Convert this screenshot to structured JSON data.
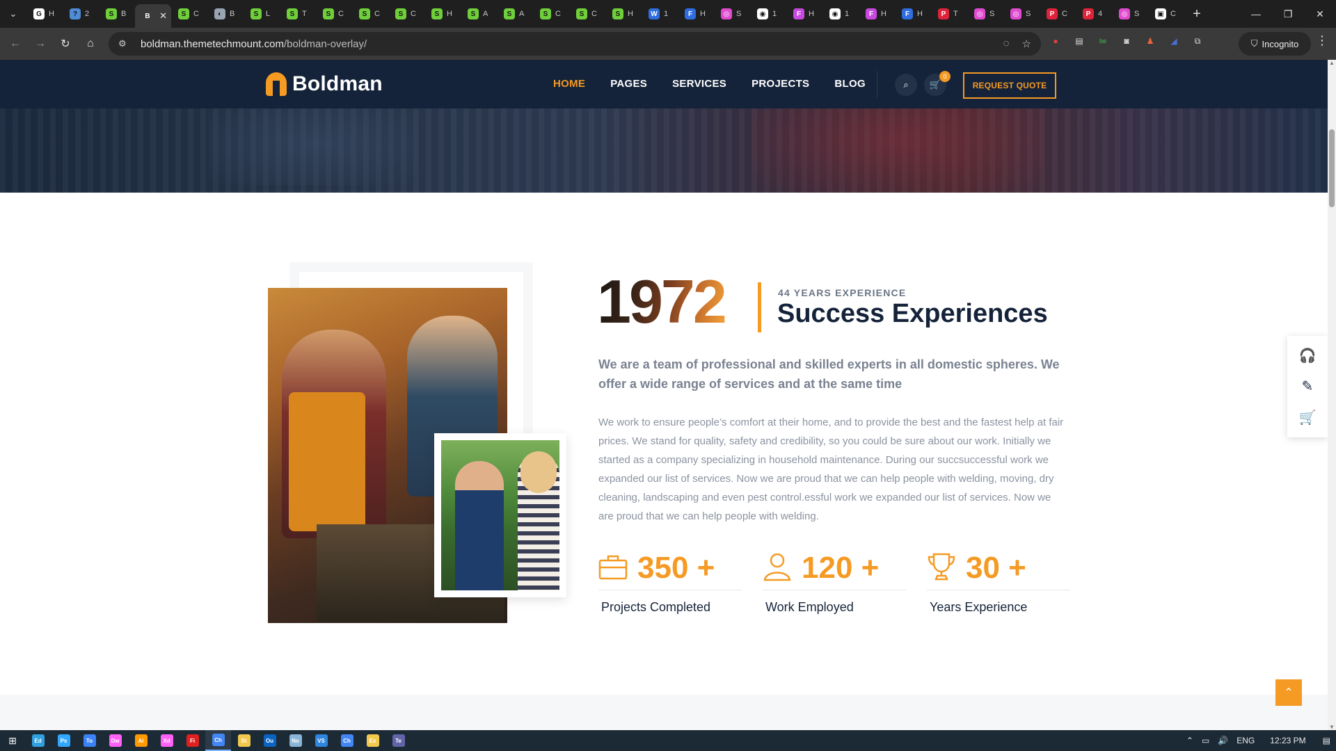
{
  "browser": {
    "tabs": [
      {
        "letter": "G",
        "label": "H",
        "color": "#ffffff"
      },
      {
        "letter": "?",
        "label": "2",
        "color": "#4f8bd6"
      },
      {
        "letter": "S",
        "label": "B",
        "color": "#6fcf3a"
      },
      {
        "letter": "B",
        "label": "",
        "color": "#3a3a3a",
        "active": true
      },
      {
        "letter": "S",
        "label": "C",
        "color": "#6fcf3a"
      },
      {
        "letter": "◐",
        "label": "B",
        "color": "#9aa3b0"
      },
      {
        "letter": "S",
        "label": "L",
        "color": "#6fcf3a"
      },
      {
        "letter": "S",
        "label": "T",
        "color": "#6fcf3a"
      },
      {
        "letter": "S",
        "label": "C",
        "color": "#6fcf3a"
      },
      {
        "letter": "S",
        "label": "C",
        "color": "#6fcf3a"
      },
      {
        "letter": "S",
        "label": "C",
        "color": "#6fcf3a"
      },
      {
        "letter": "S",
        "label": "H",
        "color": "#6fcf3a"
      },
      {
        "letter": "S",
        "label": "A",
        "color": "#6fcf3a"
      },
      {
        "letter": "S",
        "label": "A",
        "color": "#6fcf3a"
      },
      {
        "letter": "S",
        "label": "C",
        "color": "#6fcf3a"
      },
      {
        "letter": "S",
        "label": "C",
        "color": "#6fcf3a"
      },
      {
        "letter": "S",
        "label": "H",
        "color": "#6fcf3a"
      },
      {
        "letter": "W",
        "label": "1",
        "color": "#2f6de0"
      },
      {
        "letter": "F",
        "label": "H",
        "color": "#2f6de0"
      },
      {
        "letter": "◎",
        "label": "S",
        "color": "#e04bd0"
      },
      {
        "letter": "◉",
        "label": "1",
        "color": "#ffffff"
      },
      {
        "letter": "F",
        "label": "H",
        "color": "#c848e0"
      },
      {
        "letter": "◉",
        "label": "1",
        "color": "#ffffff"
      },
      {
        "letter": "F",
        "label": "H",
        "color": "#c848e0"
      },
      {
        "letter": "F",
        "label": "H",
        "color": "#2f6de0"
      },
      {
        "letter": "P",
        "label": "T",
        "color": "#e0233a"
      },
      {
        "letter": "◎",
        "label": "S",
        "color": "#e04bd0"
      },
      {
        "letter": "◎",
        "label": "S",
        "color": "#e04bd0"
      },
      {
        "letter": "P",
        "label": "C",
        "color": "#e0233a"
      },
      {
        "letter": "P",
        "label": "4",
        "color": "#e0233a"
      },
      {
        "letter": "◎",
        "label": "S",
        "color": "#e04bd0"
      },
      {
        "letter": "▣",
        "label": "C",
        "color": "#ffffff"
      }
    ],
    "url_host": "boldman.themetechmount.com",
    "url_path": "/boldman-overlay/",
    "incognito_label": "Incognito"
  },
  "header": {
    "logo_text": "Boldman",
    "nav": [
      "HOME",
      "PAGES",
      "SERVICES",
      "PROJECTS",
      "BLOG"
    ],
    "active_nav": "HOME",
    "cart_count": "0",
    "quote_button": "REQUEST QUOTE"
  },
  "about": {
    "year": "1972",
    "eyebrow": "44 YEARS EXPERIENCE",
    "title": "Success Experiences",
    "lead": "We are a team of professional and skilled experts in all domestic spheres. We offer a wide range of services and at the same time",
    "body": "We work to ensure people’s comfort at their home, and to provide the best and the fastest help at fair prices. We stand for quality, safety and credibility, so you could be sure about our work. Initially we started as a company specializing in household maintenance. During our succsuccessful work we expanded our list of services. Now we are proud that we can help people with welding, moving, dry cleaning, landscaping and even pest control.essful work we expanded our list of services. Now we are proud that we can help people with welding.",
    "stats": [
      {
        "icon": "briefcase-icon",
        "value": "350 +",
        "label": "Projects Completed"
      },
      {
        "icon": "user-icon",
        "value": "120 +",
        "label": "Work Employed"
      },
      {
        "icon": "trophy-icon",
        "value": "30 +",
        "label": "Years Experience"
      }
    ]
  },
  "colors": {
    "accent": "#f59a23",
    "navy": "#15233a"
  },
  "taskbar": {
    "apps": [
      "Edge",
      "Ps",
      "Todo",
      "Dw",
      "Ai",
      "Xd",
      "FileZilla",
      "Chrome",
      "Sticky",
      "Outlook",
      "Notepad",
      "VS Code",
      "Chrome",
      "Explorer",
      "Teams"
    ],
    "language": "ENG",
    "time": "12:23 PM"
  }
}
